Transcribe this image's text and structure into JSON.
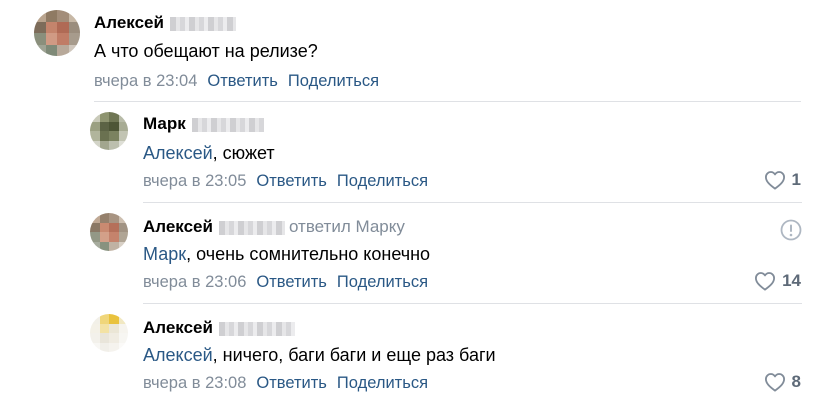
{
  "comments": [
    {
      "author": "Алексей",
      "text": "А что обещают на релизе?",
      "time": "вчера в 23:04",
      "reply_label": "Ответить",
      "share_label": "Поделиться"
    },
    {
      "author": "Марк",
      "mention": "Алексей",
      "text": ", сюжет",
      "time": "вчера в 23:05",
      "reply_label": "Ответить",
      "share_label": "Поделиться",
      "likes": "1"
    },
    {
      "author": "Алексей",
      "replied_to": "ответил Марку",
      "mention": "Марк",
      "text": ", очень сомнительно конечно",
      "time": "вчера в 23:06",
      "reply_label": "Ответить",
      "share_label": "Поделиться",
      "likes": "14"
    },
    {
      "author": "Алексей",
      "mention": "Алексей",
      "text": ", ничего, баги баги и еще раз баги",
      "time": "вчера в 23:08",
      "reply_label": "Ответить",
      "share_label": "Поделиться",
      "likes": "8"
    }
  ],
  "icons": {
    "like": "heart-outline-icon",
    "report": "exclamation-circle-icon"
  },
  "colors": {
    "link": "#2a5885",
    "muted": "#818c99",
    "like_count": "#5e6a78",
    "divider": "#dfe1e5"
  }
}
